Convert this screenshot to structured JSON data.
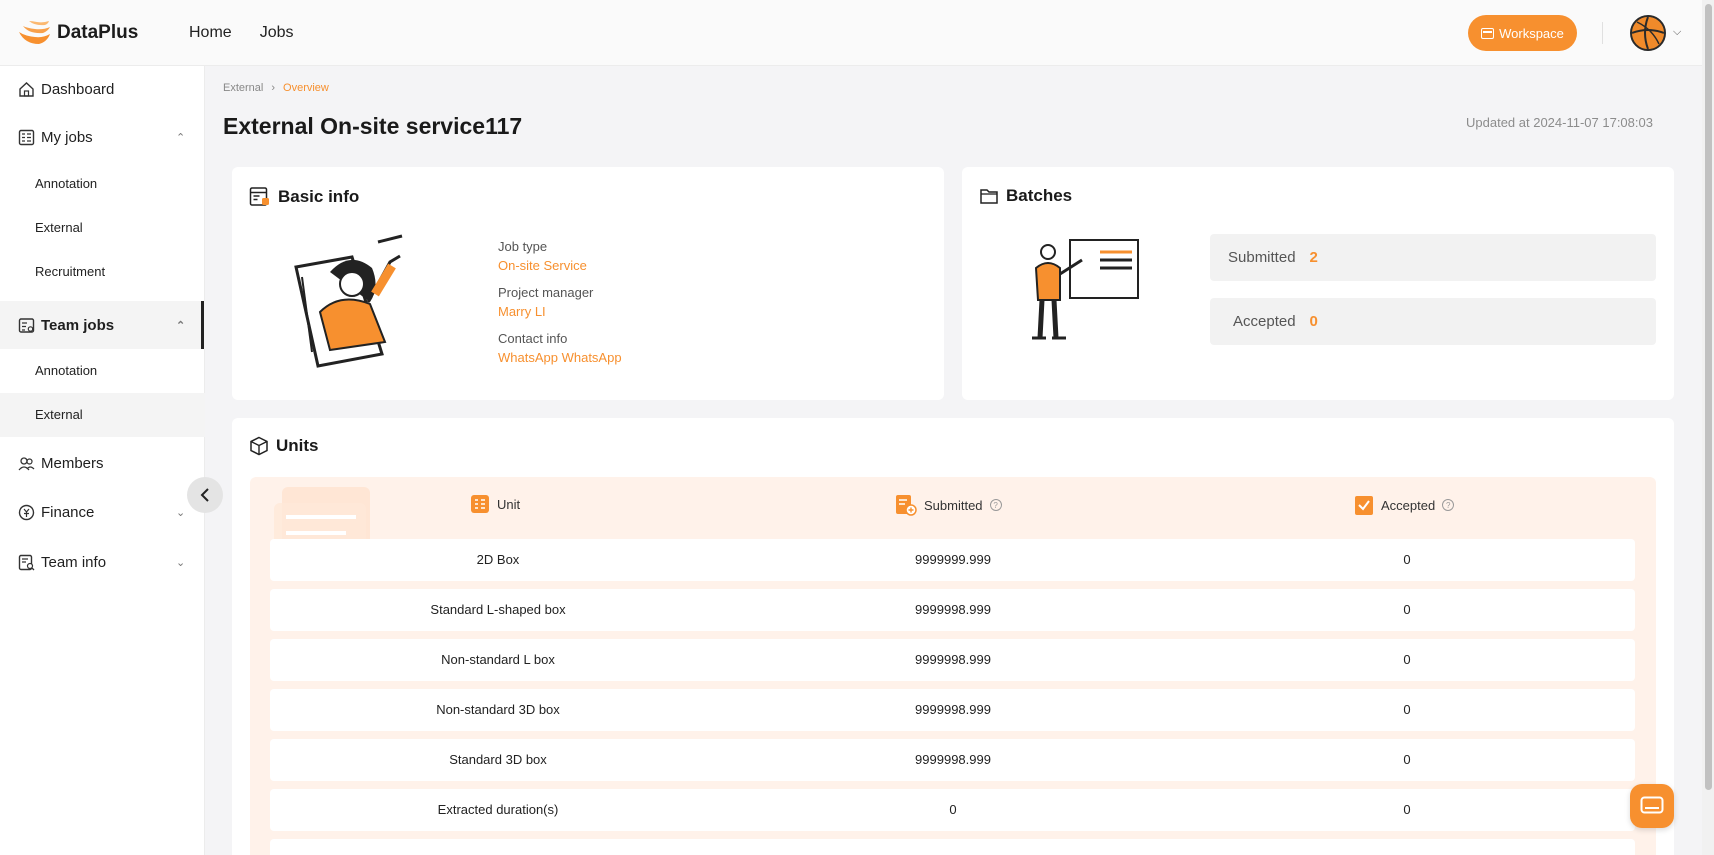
{
  "app": {
    "name": "DataPlus"
  },
  "topnav": {
    "home": "Home",
    "jobs": "Jobs",
    "workspace": "Workspace"
  },
  "sidebar": {
    "dashboard": "Dashboard",
    "my_jobs": "My jobs",
    "my_jobs_items": [
      "Annotation",
      "External",
      "Recruitment"
    ],
    "team_jobs": "Team jobs",
    "team_jobs_items": [
      "Annotation",
      "External"
    ],
    "members": "Members",
    "finance": "Finance",
    "team_info": "Team info"
  },
  "breadcrumb": {
    "parent": "External",
    "current": "Overview"
  },
  "page": {
    "title": "External On-site service117",
    "updated": "Updated at 2024-11-07 17:08:03"
  },
  "basic_info": {
    "title": "Basic info",
    "job_type_label": "Job type",
    "job_type": "On-site Service",
    "pm_label": "Project manager",
    "pm": "Marry LI",
    "contact_label": "Contact info",
    "contact": "WhatsApp WhatsApp"
  },
  "batches": {
    "title": "Batches",
    "submitted_label": "Submitted",
    "submitted": "2",
    "accepted_label": "Accepted",
    "accepted": "0"
  },
  "units": {
    "title": "Units",
    "headers": {
      "unit": "Unit",
      "submitted": "Submitted",
      "accepted": "Accepted"
    },
    "rows": [
      {
        "unit": "2D Box",
        "submitted": "9999999.999",
        "accepted": "0"
      },
      {
        "unit": "Standard L-shaped box",
        "submitted": "9999998.999",
        "accepted": "0"
      },
      {
        "unit": "Non-standard L box",
        "submitted": "9999998.999",
        "accepted": "0"
      },
      {
        "unit": "Non-standard 3D box",
        "submitted": "9999998.999",
        "accepted": "0"
      },
      {
        "unit": "Standard 3D box",
        "submitted": "9999998.999",
        "accepted": "0"
      },
      {
        "unit": "Extracted duration(s)",
        "submitted": "0",
        "accepted": "0"
      }
    ]
  },
  "colors": {
    "accent": "#f7902f",
    "sidebar_active": "#f4f4f4",
    "units_bg": "#fff2ea"
  }
}
